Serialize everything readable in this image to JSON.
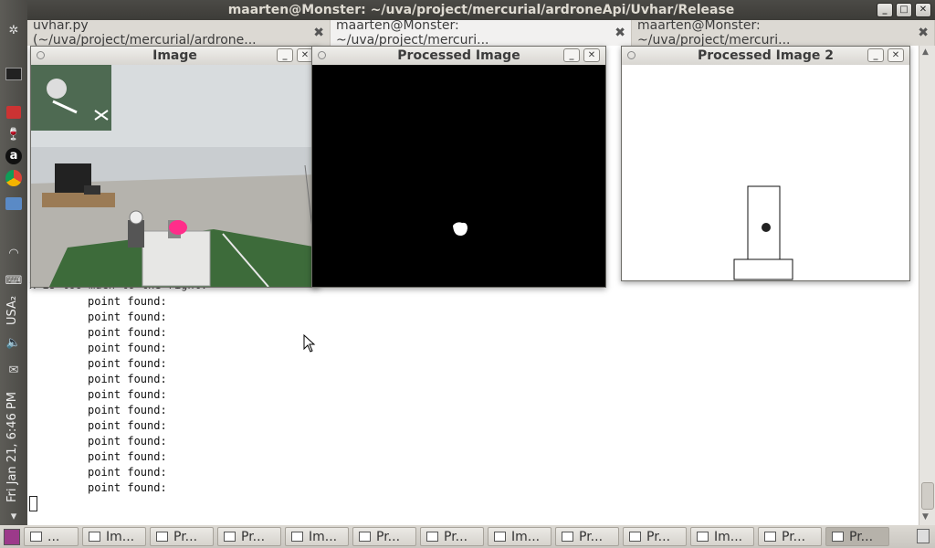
{
  "window": {
    "title": "maarten@Monster: ~/uva/project/mercurial/ardroneApi/Uvhar/Release"
  },
  "tabs": [
    {
      "label": "uvhar.py (~/uva/project/mercurial/ardrone..."
    },
    {
      "label": "maarten@Monster: ~/uva/project/mercuri..."
    },
    {
      "label": "maarten@Monster: ~/uva/project/mercuri..."
    }
  ],
  "terminal": {
    "partial_line": "x is too much to the right.",
    "lines": [
      "point found:",
      "point found:",
      "point found:",
      "point found:",
      "point found:",
      "point found:",
      "point found:",
      "point found:",
      "point found:",
      "point found:",
      "point found:",
      "point found:",
      "point found:"
    ]
  },
  "image_windows": {
    "image": {
      "title": "Image"
    },
    "processed": {
      "title": "Processed Image"
    },
    "processed2": {
      "title": "Processed Image 2"
    }
  },
  "panel": {
    "clock": "Fri Jan 21, 6:46 PM",
    "keyboard": "USA₂"
  },
  "taskbar": [
    {
      "label": "..."
    },
    {
      "label": "Im..."
    },
    {
      "label": "Pr..."
    },
    {
      "label": "Pr..."
    },
    {
      "label": "Im..."
    },
    {
      "label": "Pr..."
    },
    {
      "label": "Pr..."
    },
    {
      "label": "Im..."
    },
    {
      "label": "Pr..."
    },
    {
      "label": "Pr..."
    },
    {
      "label": "Im..."
    },
    {
      "label": "Pr..."
    },
    {
      "label": "Pr..."
    }
  ],
  "colors": {
    "panel": "#4a4945",
    "accent": "#dd4814",
    "pink_target": "#ff2d8a"
  }
}
